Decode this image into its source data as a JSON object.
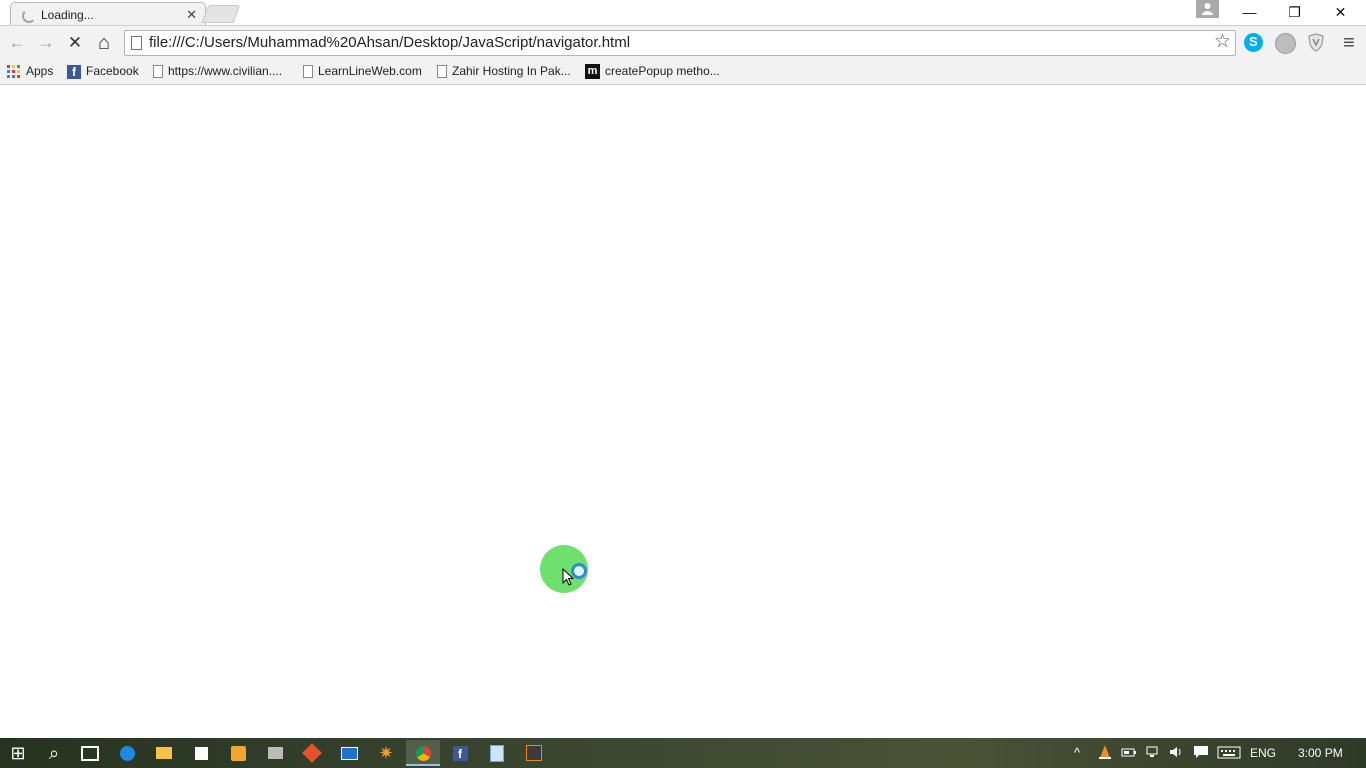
{
  "tab": {
    "title": "Loading...",
    "close_glyph": "✕"
  },
  "window": {
    "minimize": "—",
    "restore": "❐",
    "close": "✕"
  },
  "toolbar": {
    "back": "←",
    "forward": "→",
    "stop": "✕",
    "home": "⌂",
    "url": "file:///C:/Users/Muhammad%20Ahsan/Desktop/JavaScript/navigator.html",
    "bookmark_star": "☆",
    "menu": "≡"
  },
  "bookmarks": [
    {
      "label": "Apps",
      "icon": "apps-grid-icon"
    },
    {
      "label": "Facebook",
      "icon": "facebook-icon"
    },
    {
      "label": "https://www.civilian....",
      "icon": "page-icon"
    },
    {
      "label": "LearnLineWeb.com",
      "icon": "page-icon"
    },
    {
      "label": "Zahir Hosting In Pak...",
      "icon": "page-icon"
    },
    {
      "label": "createPopup metho...",
      "icon": "m-icon"
    }
  ],
  "taskbar": {
    "start": "⊞",
    "search": "⌕",
    "tray": {
      "language": "ENG",
      "time": "3:00 PM",
      "chevron": "^"
    }
  },
  "colors": {
    "toolbar_bg": "#f2f2f2",
    "click_highlight": "#6ee06e",
    "cursor_ring": "#2b8cd8",
    "skype": "#00aff0",
    "facebook": "#3b5998"
  }
}
